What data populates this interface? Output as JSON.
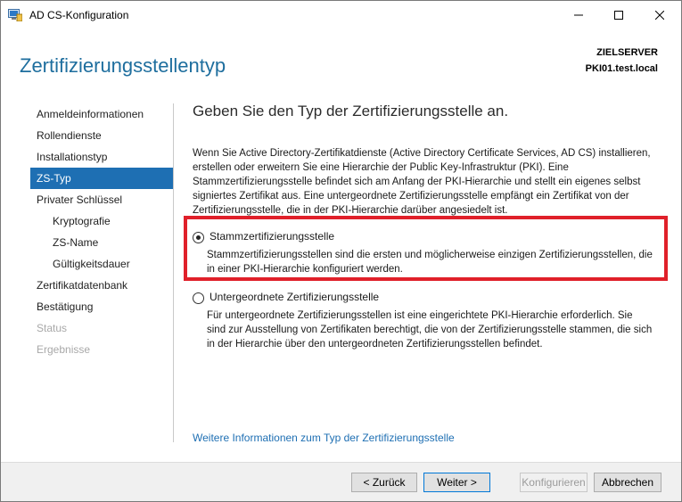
{
  "window": {
    "title": "AD CS-Konfiguration",
    "minimize_icon": "minimize-icon",
    "maximize_icon": "maximize-icon",
    "close_icon": "close-icon"
  },
  "header": {
    "page_title": "Zertifizierungsstellentyp",
    "target_label": "ZIELSERVER",
    "target_value": "PKI01.test.local"
  },
  "sidebar": {
    "items": [
      {
        "label": "Anmeldeinformationen",
        "state": "normal"
      },
      {
        "label": "Rollendienste",
        "state": "normal"
      },
      {
        "label": "Installationstyp",
        "state": "normal"
      },
      {
        "label": "ZS-Typ",
        "state": "active"
      },
      {
        "label": "Privater Schlüssel",
        "state": "normal"
      },
      {
        "label": "Kryptografie",
        "state": "sub"
      },
      {
        "label": "ZS-Name",
        "state": "sub"
      },
      {
        "label": "Gültigkeitsdauer",
        "state": "sub"
      },
      {
        "label": "Zertifikatdatenbank",
        "state": "normal"
      },
      {
        "label": "Bestätigung",
        "state": "normal"
      },
      {
        "label": "Status",
        "state": "disabled"
      },
      {
        "label": "Ergebnisse",
        "state": "disabled"
      }
    ]
  },
  "main": {
    "heading": "Geben Sie den Typ der Zertifizierungsstelle an.",
    "intro": "Wenn Sie Active Directory-Zertifikatdienste (Active Directory Certificate Services, AD CS) installieren, erstellen oder erweitern Sie eine Hierarchie der Public Key-Infrastruktur (PKI). Eine Stammzertifizierungsstelle befindet sich am Anfang der PKI-Hierarchie und stellt ein eigenes selbst signiertes Zertifikat aus. Eine untergeordnete Zertifizierungsstelle empfängt ein Zertifikat von der Zertifizierungsstelle, die in der PKI-Hierarchie darüber angesiedelt ist.",
    "options": [
      {
        "label": "Stammzertifizierungsstelle",
        "description": "Stammzertifizierungsstellen sind die ersten und möglicherweise einzigen Zertifizierungsstellen, die in einer PKI-Hierarchie konfiguriert werden.",
        "selected": true
      },
      {
        "label": "Untergeordnete Zertifizierungsstelle",
        "description": "Für untergeordnete Zertifizierungsstellen ist eine eingerichtete PKI-Hierarchie erforderlich. Sie sind zur Ausstellung von Zertifikaten berechtigt, die von der Zertifizierungsstelle stammen, die sich in der Hierarchie über den untergeordneten Zertifizierungsstellen befindet.",
        "selected": false
      }
    ],
    "more_info_link": "Weitere Informationen zum Typ der Zertifizierungsstelle"
  },
  "footer": {
    "back_label": "< Zurück",
    "next_label": "Weiter >",
    "configure_label": "Konfigurieren",
    "cancel_label": "Abbrechen"
  },
  "colors": {
    "accent": "#1e6fb3",
    "title_blue": "#1e6e9e",
    "highlight_red": "#e0202a"
  }
}
